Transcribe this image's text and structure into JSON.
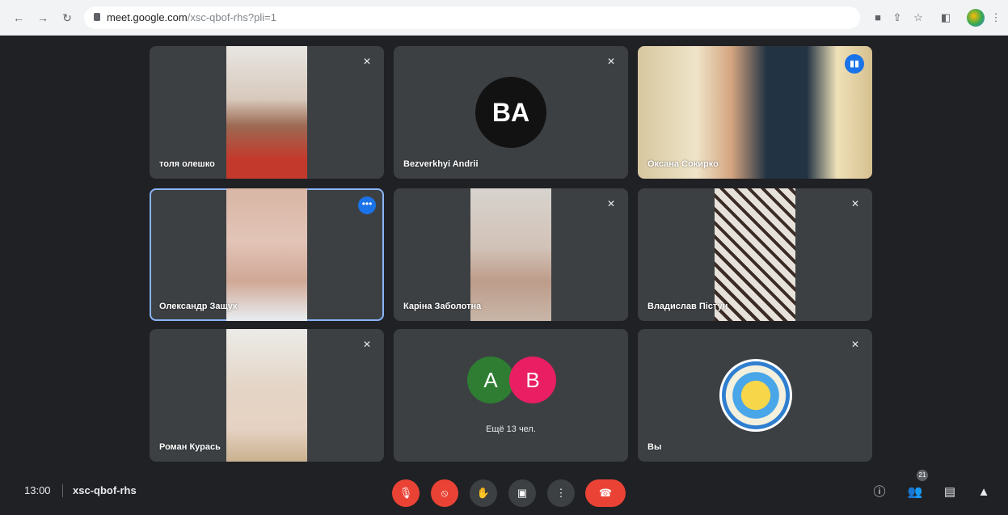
{
  "browser": {
    "url_host": "meet.google.com",
    "url_path": "/xsc-qbof-rhs?pli=1",
    "back_icon": "arrow-left-icon",
    "forward_icon": "arrow-right-icon",
    "reload_icon": "reload-icon"
  },
  "tiles": [
    {
      "name": "толя олешко"
    },
    {
      "name": "Bezverkhyi Andrii",
      "avatar_text": "BA"
    },
    {
      "name": "Оксана Сокирко"
    },
    {
      "name": "Олександр Защук"
    },
    {
      "name": "Каріна Заболотна"
    },
    {
      "name": "Владислав Пістун"
    },
    {
      "name": "Роман Курась"
    },
    {
      "others_text": "Ещё 13 чел.",
      "bubbles": [
        "A",
        "B"
      ]
    },
    {
      "name": "Вы"
    }
  ],
  "meeting": {
    "time": "13:00",
    "code": "xsc-qbof-rhs",
    "participant_count": "21"
  },
  "colors": {
    "background": "#202124",
    "tile": "#3c4043",
    "accent": "#1a73e8",
    "danger": "#ea4335",
    "bubble_a": "#2e7d32",
    "bubble_b": "#e91e63"
  }
}
